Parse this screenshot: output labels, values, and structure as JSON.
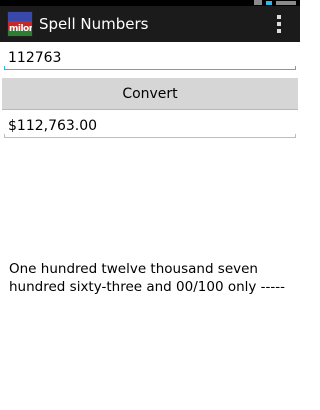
{
  "app": {
    "title": "Spell Numbers",
    "icon_text": "milon",
    "icon_name": "app-logo-icon",
    "menu_icon_name": "overflow-menu-icon"
  },
  "form": {
    "number_value": "112763",
    "convert_label": "Convert",
    "currency_value": "$112,763.00"
  },
  "output": {
    "words": "One hundred twelve thousand seven hundred sixty-three and 00/100 only -----"
  },
  "colors": {
    "action_bar": "#1b1b1b",
    "accent": "#33b5e5",
    "button": "#d6d6d6",
    "background": "#ffffff"
  }
}
